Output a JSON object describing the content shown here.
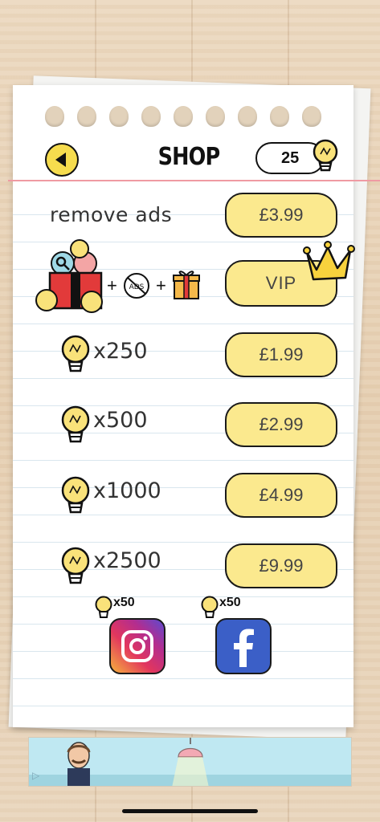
{
  "header": {
    "title": "SHOP",
    "bulb_count": "25"
  },
  "rows": [
    {
      "label": "remove ads",
      "price": "£3.99"
    },
    {
      "label": "",
      "price": "VIP",
      "icons": [
        "gift-box-icon",
        "no-ads-icon",
        "present-icon"
      ]
    },
    {
      "label": "x250",
      "price": "£1.99"
    },
    {
      "label": "x500",
      "price": "£2.99"
    },
    {
      "label": "x1000",
      "price": "£4.99"
    },
    {
      "label": "x2500",
      "price": "£9.99"
    }
  ],
  "vip_plus_sign": "+",
  "no_ads_text": "ADS",
  "social": {
    "instagram_reward": "x50",
    "facebook_reward": "x50"
  },
  "colors": {
    "button_yellow": "#fbe98e",
    "back_button": "#f6dc4e",
    "bulb": "#f9e27a",
    "red_margin": "#ef9aa3",
    "facebook": "#3b5fc7"
  }
}
